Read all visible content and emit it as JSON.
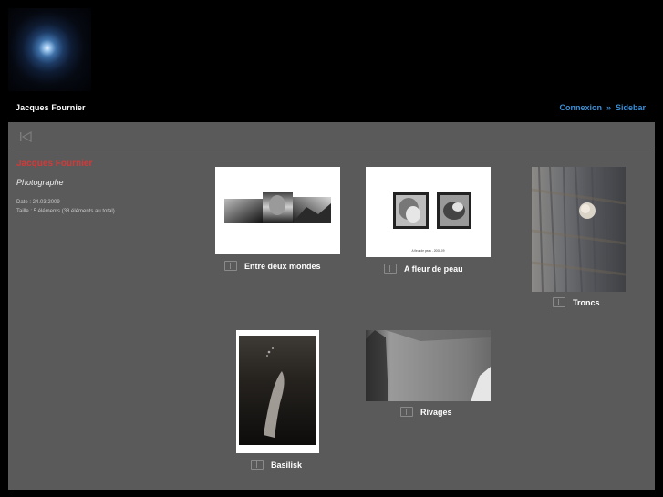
{
  "header": {
    "site_title": "Jacques Fournier",
    "links": [
      "Connexion",
      "Sidebar"
    ],
    "separator": "»"
  },
  "toolbar": {
    "first_icon": "first-page-icon"
  },
  "album": {
    "title": "Jacques Fournier",
    "subtitle": "Photographe",
    "date": "Date : 24.03.2009",
    "size": "Taille : 5 éléments (38 éléments au total)"
  },
  "items": [
    {
      "title": "Entre deux mondes",
      "icon": "album-icon"
    },
    {
      "title": "A fleur de peau",
      "icon": "album-icon",
      "thumb_caption": "A fleur de peau - 2008-09"
    },
    {
      "title": "Troncs",
      "icon": "album-icon"
    },
    {
      "title": "Basilisk",
      "icon": "album-icon"
    },
    {
      "title": "Rivages",
      "icon": "album-icon"
    }
  ],
  "colors": {
    "page_bg": "#000000",
    "content_bg": "#5a5a5a",
    "album_title": "#d23a3a",
    "link": "#3b8fd6"
  }
}
